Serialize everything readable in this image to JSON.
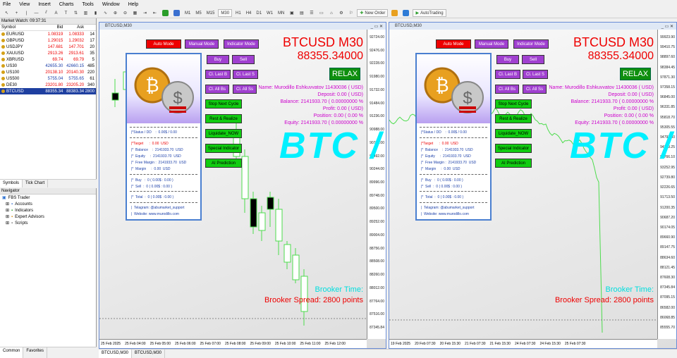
{
  "menu": [
    "File",
    "View",
    "Insert",
    "Charts",
    "Tools",
    "Window",
    "Help"
  ],
  "toolbar": {
    "timeframes": [
      "M1",
      "M5",
      "M15",
      "M30",
      "H1",
      "H4",
      "D1",
      "W1",
      "MN"
    ],
    "new_order": "New Order",
    "autotrading": "AutoTrading"
  },
  "market_watch": {
    "title": "Market Watch: 09:37:31",
    "headers": [
      "Symbol",
      "Bid",
      "Ask",
      ""
    ],
    "rows": [
      [
        "EURUSD",
        "1.08319",
        "1.08333",
        "14"
      ],
      [
        "GBPUSD",
        "1.29015",
        "1.29032",
        "17"
      ],
      [
        "USDJPY",
        "147.681",
        "147.701",
        "20"
      ],
      [
        "XAUUSD",
        "2913.26",
        "2913.61",
        "35"
      ],
      [
        "XBRUSD",
        "69.74",
        "69.79",
        "5"
      ],
      [
        "US30",
        "42655.30",
        "42660.15",
        "485"
      ],
      [
        "US100",
        "20138.10",
        "20140.30",
        "220"
      ],
      [
        "US500",
        "5755.04",
        "5755.65",
        "61"
      ],
      [
        "DE30",
        "23201.80",
        "23205.20",
        "340"
      ],
      [
        "BTCUSD",
        "88355.34",
        "88383.34",
        "2800"
      ]
    ],
    "tabs": [
      "Symbols",
      "Tick Chart"
    ]
  },
  "navigator": {
    "title": "Navigator",
    "items": [
      "FBS Trader",
      "Accounts",
      "Indicators",
      "Expert Advisors",
      "Scripts"
    ],
    "tabs": [
      "Common",
      "Favorites"
    ]
  },
  "chart1": {
    "window_title": "BTCUSD,M30",
    "dates": [
      "25 Feb 2025",
      "25 Feb 04:00",
      "25 Feb 05:00",
      "25 Feb 06:00",
      "25 Feb 07:00",
      "25 Feb 08:00",
      "25 Feb 09:00",
      "25 Feb 10:00",
      "25 Feb 11:00",
      "25 Feb 12:00"
    ],
    "prices": [
      "92724.00",
      "92476.00",
      "92228.00",
      "91980.00",
      "91732.00",
      "91484.00",
      "91236.00",
      "90988.00",
      "90740.00",
      "90492.00",
      "90244.00",
      "89996.00",
      "89748.00",
      "89500.00",
      "89252.00",
      "89004.00",
      "88756.00",
      "88508.00",
      "88260.00",
      "88012.00",
      "87764.00",
      "87516.00",
      "87345.84"
    ]
  },
  "chart2": {
    "window_title": "BTCUSD,M30",
    "dates": [
      "19 Feb 2025",
      "20 Feb 07:30",
      "20 Feb 15:30",
      "21 Feb 07:30",
      "21 Feb 15:30",
      "24 Feb 07:30",
      "24 Feb 15:30",
      "25 Feb 07:30"
    ],
    "prices": [
      "99923.90",
      "99410.75",
      "98897.60",
      "98384.45",
      "97871.30",
      "97358.15",
      "96845.00",
      "96331.85",
      "95818.70",
      "95305.55",
      "94792.40",
      "94279.25",
      "93766.10",
      "93252.95",
      "92739.80",
      "92226.65",
      "91713.50",
      "91200.35",
      "90687.20",
      "90174.05",
      "89660.90",
      "89147.75",
      "88634.60",
      "88121.45",
      "87608.30",
      "87345.84",
      "87095.15",
      "86582.00",
      "86068.85",
      "85555.70"
    ]
  },
  "ea": {
    "title": "BTCUSD M30",
    "price": "88355.34000",
    "relax": "RELAX",
    "name": "Name: Murodillo Eshkuvvatov 11430036 ( USD)",
    "deposit": "Deposit: 0.00 ( USD)",
    "balance": "Balance: 2141933.70 ( 0.00000000 %",
    "profit": "Profit: 0.00 ( USD)",
    "position": "Position: 0.00 ( 0.00 %",
    "equity": "Equity: 2141933.70 ( 0.00000000 %",
    "watermark": "BTC /",
    "broker_time": "Brooker Time:",
    "broker_spread": "Brooker Spread: 2800 points",
    "modes": [
      "Auto Mode",
      "Manual Mode",
      "Indicator Mode"
    ],
    "buttons": [
      "Buy",
      "Sell",
      "Cl. Last B",
      "Cl. Last S",
      "Cl. All Bs",
      "Cl. All Ss",
      "Stop Next Cycle",
      "Rest & Realize",
      "Liquidate_NOW",
      "Special Indicator",
      "AI Prediction"
    ]
  },
  "panel": {
    "status": "|*Status / DD    :  0.00$ / 0.00",
    "target": "|*Target      :  0.00  USD",
    "balance": "|*  Balance    :  2141933.70  USD",
    "equity": "|*  Equity     :  2141933.70  USD",
    "free_margin": "|*  Free Margin :  2141933.70  USD",
    "margin": "|*  Margin     :  0.00  USD",
    "buy": "|*  Buy   :  0 ( 0.00$ : 0.00 )",
    "sell": "|*  Sell  :  0 ( 0.00$ : 0.00 )",
    "total": "|*  Total  :  0 ( 0.00$ : 0.00 )",
    "telegram": "|  Telagram: @abumarket_support",
    "website": "|  Website: www.murodillo.com"
  },
  "bottom_tabs": [
    "BTCUSD,M30",
    "BTCUSD,M30"
  ],
  "colors": {
    "sell_red": "#e00000",
    "mode_purple": "#a040d0",
    "green_btn": "#11cc11",
    "cyan": "#00f0ff"
  }
}
